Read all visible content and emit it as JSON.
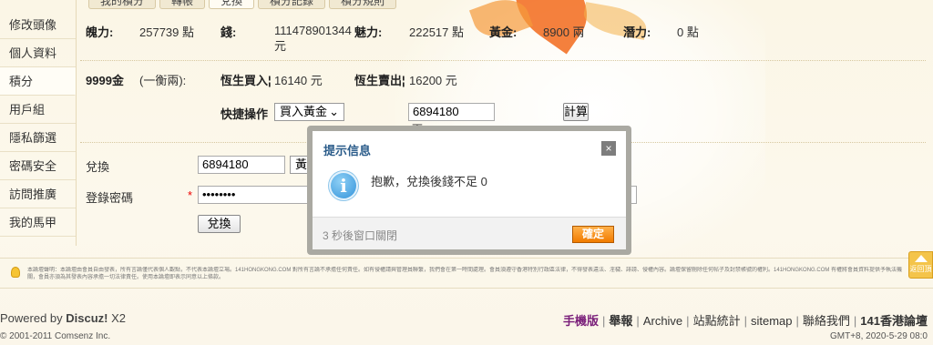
{
  "tabs": [
    "我的積分",
    "轉帳",
    "兌換",
    "積分記錄",
    "積分規則"
  ],
  "active_tab_index": 2,
  "sidebar": {
    "items": [
      {
        "label": "修改頭像"
      },
      {
        "label": "個人資料"
      },
      {
        "label": "積分"
      },
      {
        "label": "用戶組"
      },
      {
        "label": "隱私篩選"
      },
      {
        "label": "密碼安全"
      },
      {
        "label": "訪問推廣"
      },
      {
        "label": "我的馬甲"
      }
    ],
    "active_index": 2
  },
  "stats": {
    "power_label": "魄力:",
    "power_value": "257739 點",
    "money_label": "錢:",
    "money_value": "111478901344 元",
    "charm_label": "魅力:",
    "charm_value": "222517 點",
    "gold_label": "黃金:",
    "gold_value": "8900 兩",
    "potential_label": "潛力:",
    "potential_value": "0 點"
  },
  "rate": {
    "unit_label": "9999金",
    "unit_desc": "(一衡兩):",
    "buy_label": "恆生買入¦",
    "buy_value": "16140 元",
    "sell_label": "恆生賣出¦",
    "sell_value": "16200 元"
  },
  "quick": {
    "label": "快捷操作",
    "select_value": "買入黃金",
    "amount": "6894180",
    "unit": "兩",
    "calc_button": "計算"
  },
  "exchange": {
    "label": "兌換",
    "amount": "6894180",
    "select_value": "黃金",
    "password_label": "登錄密碼",
    "password_required": "*",
    "password_value": "••••••••",
    "submit_button": "兌換"
  },
  "dialog": {
    "title": "提示信息",
    "close": "×",
    "icon": "info-icon",
    "message": "抱歉，兌換後錢不足 0",
    "timer": "3 秒後窗口關閉",
    "ok_button": "確定"
  },
  "notice": {
    "text": "本論壇聲明：本論壇由會員自由發表，所有言論僅代表個人觀點，不代表本論壇立場。141HONGKONG.COM 對所有言論不承擔任何責任。如有侵權請與管理員聯繫，我們會在第一時間處理。會員須遵守香港特別行政區法律，不得發表違法、淫穢、誹謗、侵權內容。論壇保留刪除任何帖子及封禁帳號的權利。141HONGKONG.COM 有權將會員資料提供予執法機關，會員亦須為其發表內容承擔一切法律責任。使用本論壇即表示同意以上條款。"
  },
  "footer": {
    "powered": "Powered by ",
    "brand": "Discuz!",
    "version": " X2",
    "copyright": "© 2001-2011 Comsenz Inc.",
    "links": [
      "手機版",
      "舉報",
      "Archive",
      "站點統計",
      "sitemap",
      "聯絡我們",
      "141香港論壇"
    ],
    "time": "GMT+8, 2020-5-29 08:0"
  },
  "scroll_top": "返回頂部",
  "colors": {
    "accent": "#f17b00",
    "title_blue": "#2b5c8a",
    "link_purple": "#7a1f7a"
  }
}
